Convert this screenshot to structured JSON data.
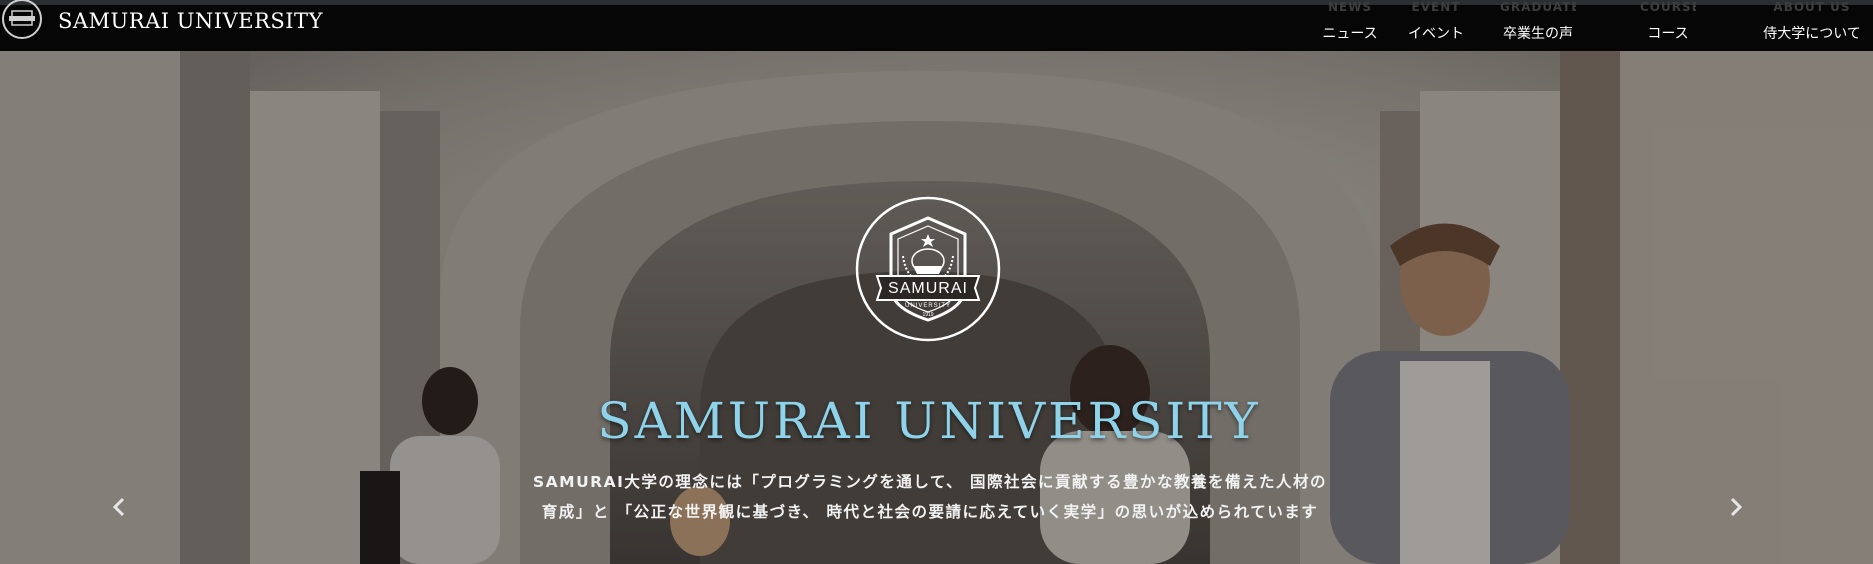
{
  "brand": {
    "name": "SAMURAI UNIVERSITY",
    "logo_icon": "samurai-crest-icon"
  },
  "nav": {
    "items": [
      {
        "en": "NEWS",
        "ja": "ニュース"
      },
      {
        "en": "EVENT",
        "ja": "イベント"
      },
      {
        "en": "GRADUATES",
        "ja": "卒業生の声"
      },
      {
        "en": "COURSE",
        "ja": "コース"
      },
      {
        "en": "ABOUT US",
        "ja": "侍大学について"
      }
    ]
  },
  "hero": {
    "crest": {
      "text": "SAMURAI",
      "sub": "UNIVERSITY",
      "year": "1919"
    },
    "title": "SAMURAI UNIVERSITY",
    "description_line1": "SAMURAI大学の理念には「プログラミングを通して、 国際社会に貢献する豊かな教養を備えた人材の",
    "description_line2": "育成」と 「公正な世界観に基づき、 時代と社会の要請に応えていく実学」の思いが込められています",
    "prev_icon": "chevron-left-icon",
    "next_icon": "chevron-right-icon"
  },
  "colors": {
    "title": "#8fd3ea",
    "navbar": "#060606"
  }
}
